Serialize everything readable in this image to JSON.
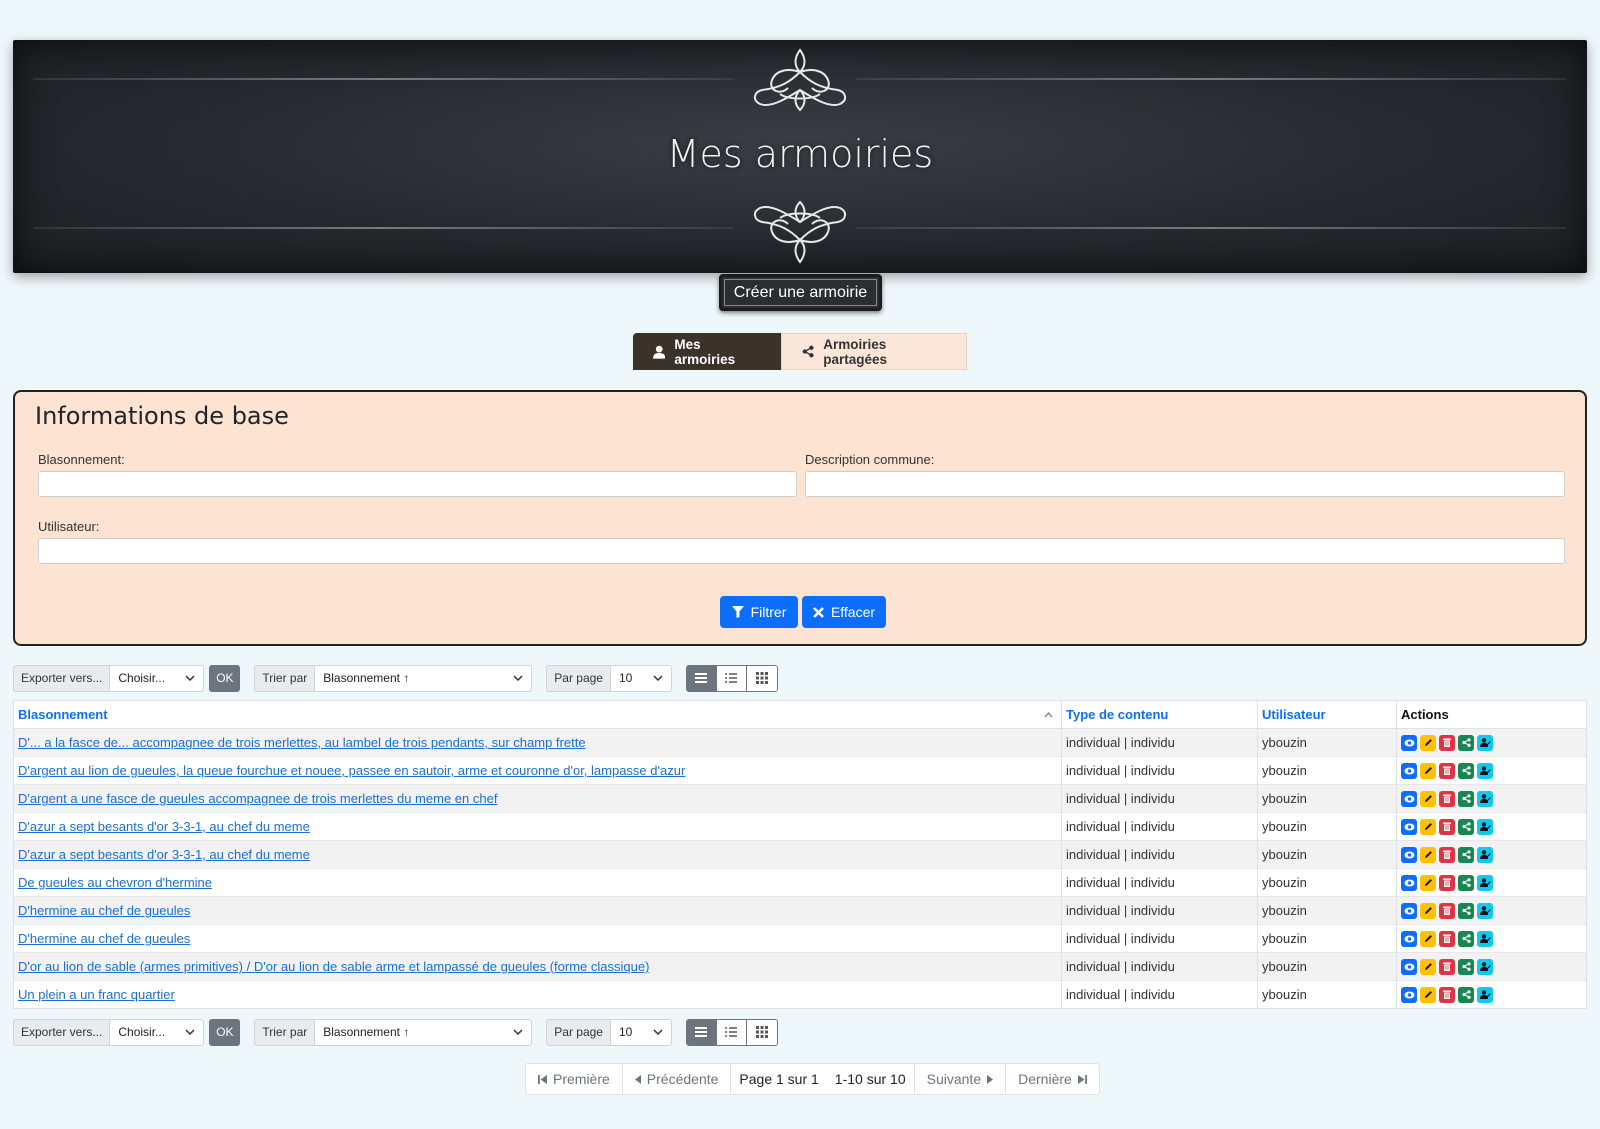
{
  "banner": {
    "title": "Mes armoiries"
  },
  "create_button": "Créer une armoirie",
  "tabs": [
    {
      "label": "Mes armoiries",
      "active": true
    },
    {
      "label": "Armoiries partagées",
      "active": false
    }
  ],
  "filter": {
    "heading": "Informations de base",
    "blasonnement_label": "Blasonnement:",
    "description_label": "Description commune:",
    "utilisateur_label": "Utilisateur:",
    "filter_button": "Filtrer",
    "clear_button": "Effacer"
  },
  "toolbar": {
    "export_label": "Exporter vers...",
    "export_select": "Choisir...",
    "ok_button": "OK",
    "sort_label": "Trier par",
    "sort_select": "Blasonnement ↑",
    "perpage_label": "Par page",
    "perpage_select": "10"
  },
  "table": {
    "headers": [
      "Blasonnement",
      "Type de contenu",
      "Utilisateur",
      "Actions"
    ],
    "rows": [
      {
        "blason": "D'... a la fasce de... accompagnee de trois merlettes, au lambel de trois pendants, sur champ frette",
        "type": "individual | individu",
        "user": "ybouzin"
      },
      {
        "blason": "D'argent au lion de gueules, la queue fourchue et nouee, passee en sautoir, arme et couronne d'or, lampasse d'azur",
        "type": "individual | individu",
        "user": "ybouzin"
      },
      {
        "blason": "D'argent a une fasce de gueules accompagnee de trois merlettes du meme en chef",
        "type": "individual | individu",
        "user": "ybouzin"
      },
      {
        "blason": "D'azur a sept besants d'or 3-3-1, au chef du meme",
        "type": "individual | individu",
        "user": "ybouzin"
      },
      {
        "blason": "D'azur a sept besants d'or 3-3-1, au chef du meme",
        "type": "individual | individu",
        "user": "ybouzin"
      },
      {
        "blason": "De gueules au chevron d'hermine",
        "type": "individual | individu",
        "user": "ybouzin"
      },
      {
        "blason": "D'hermine au chef de gueules",
        "type": "individual | individu",
        "user": "ybouzin"
      },
      {
        "blason": "D'hermine au chef de gueules",
        "type": "individual | individu",
        "user": "ybouzin"
      },
      {
        "blason": "D'or au lion de sable (armes primitives) / D'or au lion de sable arme et lampassé de gueules (forme classique)",
        "type": "individual | individu",
        "user": "ybouzin"
      },
      {
        "blason": "Un plein a un franc quartier",
        "type": "individual | individu",
        "user": "ybouzin"
      }
    ],
    "action_icons": [
      "eye-icon",
      "pencil-icon",
      "trash-icon",
      "share-icon",
      "user-edit-icon"
    ]
  },
  "pagination": {
    "first": "Première",
    "prev": "Précédente",
    "page_info": "Page 1 sur 1",
    "range_info": "1-10 sur 10",
    "next": "Suivante",
    "last": "Dernière"
  },
  "colors": {
    "primary": "#0d6efd",
    "panel_bg": "#fde3d1",
    "banner_bg": "#26292e",
    "tab_active": "#3b3329"
  }
}
